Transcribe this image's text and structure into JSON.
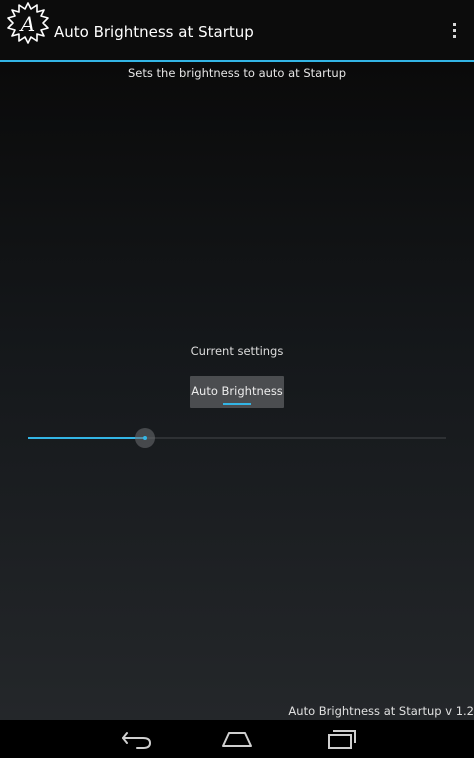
{
  "actionbar": {
    "title": "Auto Brightness at Startup",
    "app_icon": "app-logo-icon",
    "overflow_icon": "overflow-menu-icon"
  },
  "main": {
    "subtitle": "Sets the brightness to auto at Startup",
    "current_label": "Current settings",
    "mode_button_label": "Auto Brightness",
    "slider": {
      "value_fraction": 0.28
    },
    "version_text": "Auto Brightness at Startup v 1.2"
  },
  "navbar": {
    "back_icon": "back-icon",
    "home_icon": "home-icon",
    "recents_icon": "recents-icon"
  },
  "colors": {
    "accent": "#33b5e5",
    "actionbar_bg": "#0c0c0c",
    "button_bg": "#4b4d50"
  }
}
